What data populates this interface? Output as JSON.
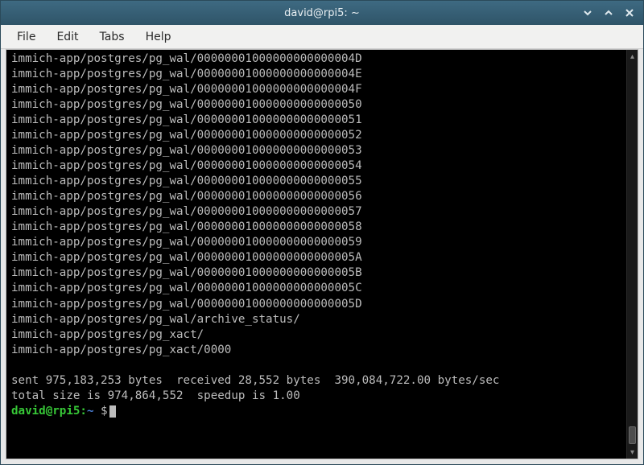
{
  "window": {
    "title": "david@rpi5: ~"
  },
  "menubar": {
    "items": [
      "File",
      "Edit",
      "Tabs",
      "Help"
    ]
  },
  "terminal": {
    "lines": [
      "immich-app/postgres/pg_wal/00000001000000000000004D",
      "immich-app/postgres/pg_wal/00000001000000000000004E",
      "immich-app/postgres/pg_wal/00000001000000000000004F",
      "immich-app/postgres/pg_wal/000000010000000000000050",
      "immich-app/postgres/pg_wal/000000010000000000000051",
      "immich-app/postgres/pg_wal/000000010000000000000052",
      "immich-app/postgres/pg_wal/000000010000000000000053",
      "immich-app/postgres/pg_wal/000000010000000000000054",
      "immich-app/postgres/pg_wal/000000010000000000000055",
      "immich-app/postgres/pg_wal/000000010000000000000056",
      "immich-app/postgres/pg_wal/000000010000000000000057",
      "immich-app/postgres/pg_wal/000000010000000000000058",
      "immich-app/postgres/pg_wal/000000010000000000000059",
      "immich-app/postgres/pg_wal/00000001000000000000005A",
      "immich-app/postgres/pg_wal/00000001000000000000005B",
      "immich-app/postgres/pg_wal/00000001000000000000005C",
      "immich-app/postgres/pg_wal/00000001000000000000005D",
      "immich-app/postgres/pg_wal/archive_status/",
      "immich-app/postgres/pg_xact/",
      "immich-app/postgres/pg_xact/0000",
      "",
      "sent 975,183,253 bytes  received 28,552 bytes  390,084,722.00 bytes/sec",
      "total size is 974,864,552  speedup is 1.00"
    ],
    "prompt": {
      "user_host": "david@rpi5",
      "colon": ":",
      "path": "~",
      "dollar": " $"
    }
  }
}
